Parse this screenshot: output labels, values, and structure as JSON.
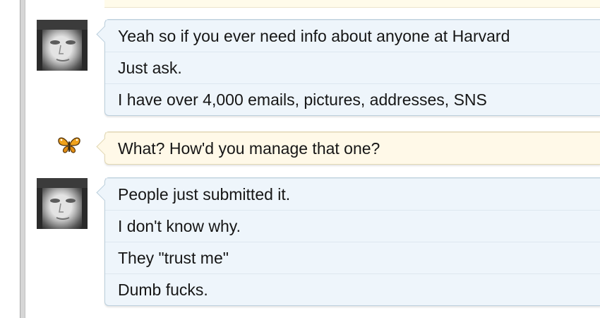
{
  "conversation": {
    "messages": [
      {
        "sender_icon": "user-avatar-icon",
        "lines": [
          "Yeah so if you ever need info about anyone at Harvard",
          "Just ask.",
          "I have over 4,000 emails, pictures, addresses, SNS"
        ]
      },
      {
        "sender_icon": "butterfly-icon",
        "lines": [
          "What? How'd you manage that one?"
        ]
      },
      {
        "sender_icon": "user-avatar-icon",
        "lines": [
          "People just submitted it.",
          "I don't know why.",
          "They \"trust me\"",
          "Dumb fucks."
        ]
      }
    ]
  },
  "colors": {
    "blue_bubble": "#eef5fb",
    "yellow_bubble": "#fff9e8",
    "butterfly": "#f0a21c"
  }
}
